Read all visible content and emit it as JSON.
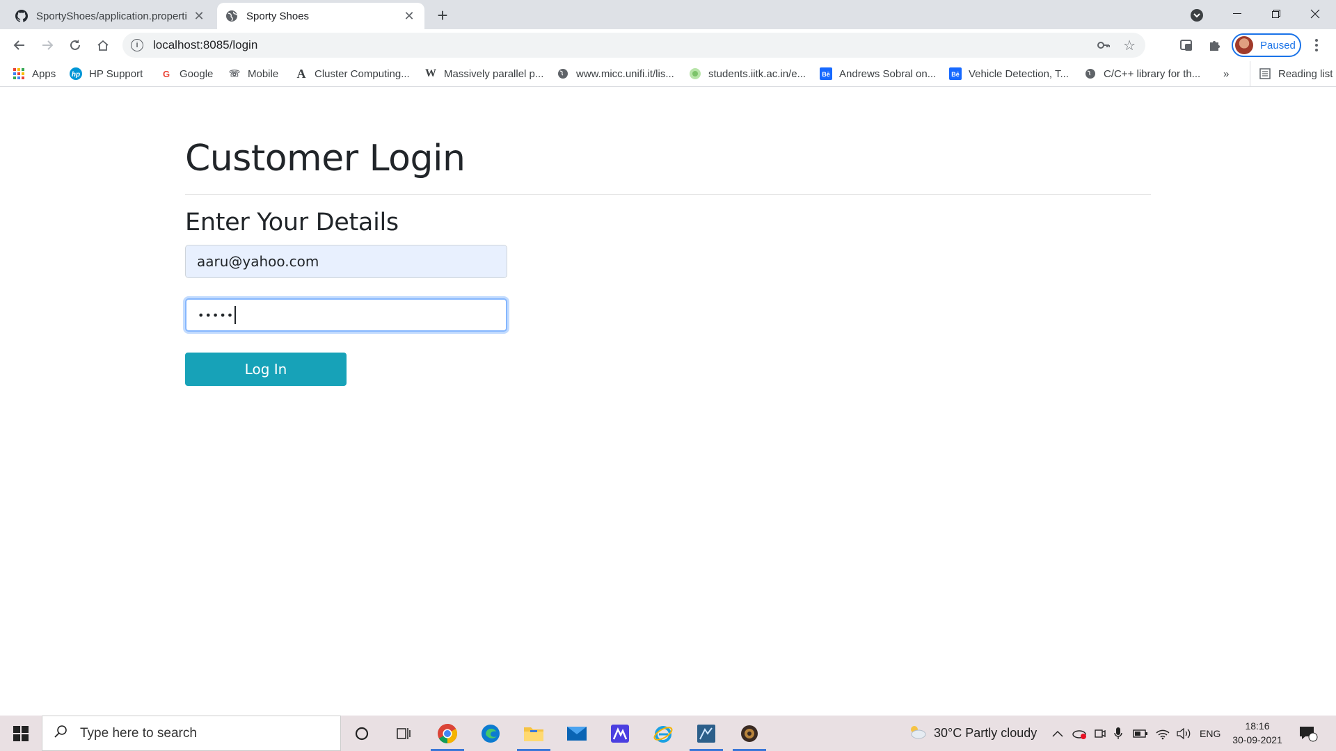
{
  "browser": {
    "tabs": [
      {
        "title": "SportyShoes/application.properti",
        "active": false
      },
      {
        "title": "Sporty Shoes",
        "active": true
      }
    ],
    "url": "localhost:8085/login",
    "profile_label": "Paused",
    "bookmarks": [
      {
        "label": "Apps",
        "icon": "apps-grid-icon"
      },
      {
        "label": "HP Support",
        "icon": "hp-icon"
      },
      {
        "label": "Google",
        "icon": "google-icon"
      },
      {
        "label": "Mobile",
        "icon": "mobile-icon"
      },
      {
        "label": "Cluster Computing...",
        "icon": "a-letter-icon"
      },
      {
        "label": "Massively parallel p...",
        "icon": "wikipedia-icon"
      },
      {
        "label": "www.micc.unifi.it/lis...",
        "icon": "globe-icon"
      },
      {
        "label": "students.iitk.ac.in/e...",
        "icon": "site-icon"
      },
      {
        "label": "Andrews Sobral on...",
        "icon": "behance-icon"
      },
      {
        "label": "Vehicle Detection, T...",
        "icon": "behance-icon"
      },
      {
        "label": "C/C++ library for th...",
        "icon": "globe-icon"
      }
    ],
    "more_bookmarks": "»",
    "reading_list": "Reading list"
  },
  "page": {
    "title": "Customer Login",
    "subtitle": "Enter Your Details",
    "email_value": "aaru@yahoo.com",
    "password_mask": "•••••",
    "login_label": "Log In"
  },
  "taskbar": {
    "search_placeholder": "Type here to search",
    "weather": "30°C  Partly cloudy",
    "lang": "ENG",
    "time": "18:16",
    "date": "30-09-2021",
    "notification_count": "1"
  }
}
